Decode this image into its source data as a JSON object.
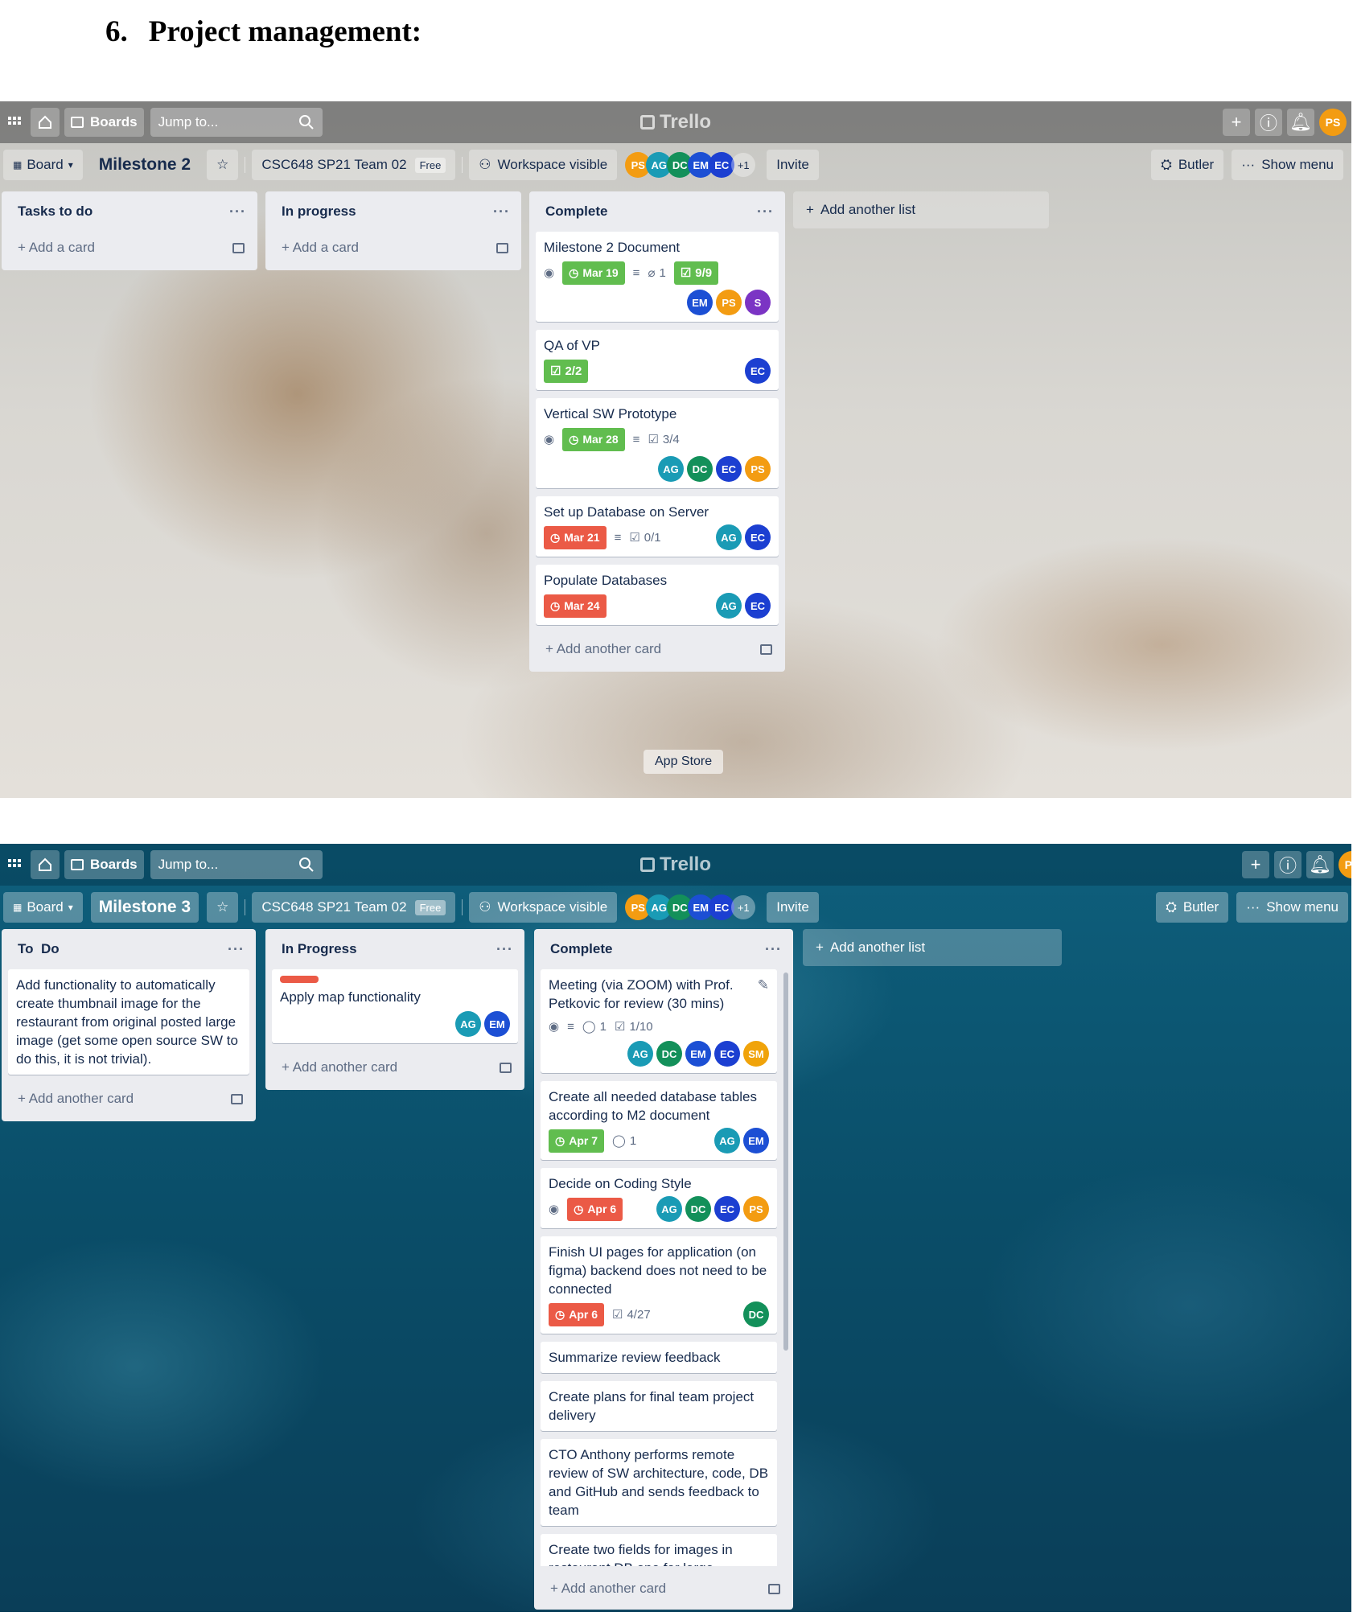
{
  "heading": {
    "number": "6.",
    "text": "Project management:"
  },
  "common": {
    "boards_label": "Boards",
    "jump_placeholder": "Jump to...",
    "logo_text": "Trello",
    "board_view_label": "Board",
    "workspace_name": "CSC648 SP21 Team 02",
    "free_badge": "Free",
    "visibility_label": "Workspace visible",
    "invite_label": "Invite",
    "butler_label": "Butler",
    "show_menu_label": "Show menu",
    "add_list_label": "Add another list",
    "more_members": "+1",
    "user_initials": "PS",
    "members": [
      "PS",
      "AG",
      "DC",
      "EM",
      "EC"
    ],
    "member_colors": {
      "PS": "#f39c12",
      "AG": "#1a9bb5",
      "DC": "#13905a",
      "EM": "#1c4fd4",
      "EC": "#1c3fd1",
      "S": "#7b34c4",
      "SM": "#f0a30a"
    }
  },
  "board1": {
    "title": "Milestone 2",
    "app_store_label": "App Store",
    "lists": [
      {
        "name": "Tasks to do",
        "add_label": "Add a card"
      },
      {
        "name": "In progress",
        "add_label": "Add a card"
      },
      {
        "name": "Complete",
        "add_label": "Add another card",
        "cards": [
          {
            "title": "Milestone 2 Document",
            "due": "Mar 19",
            "attachments": "1",
            "checklist": "9/9",
            "members": [
              "EM",
              "PS",
              "S"
            ]
          },
          {
            "title": "QA of VP",
            "checklist": "2/2",
            "members": [
              "EC"
            ]
          },
          {
            "title": "Vertical SW Prototype",
            "due": "Mar 28",
            "checklist": "3/4",
            "members": [
              "AG",
              "DC",
              "EC",
              "PS"
            ]
          },
          {
            "title": "Set up Database on Server",
            "due": "Mar 21",
            "checklist": "0/1",
            "members": [
              "AG",
              "EC"
            ]
          },
          {
            "title": "Populate Databases",
            "due": "Mar 24",
            "members": [
              "AG",
              "EC"
            ]
          }
        ]
      }
    ]
  },
  "board2": {
    "title": "Milestone 3",
    "lists": [
      {
        "name": "To  Do",
        "add_label": "Add another card",
        "cards": [
          {
            "title": "Add functionality to automatically create thumbnail image for the restaurant from original posted large image (get some open source SW to do this, it is not trivial)."
          }
        ]
      },
      {
        "name": "In Progress",
        "add_label": "Add another card",
        "cards": [
          {
            "title": "Apply map functionality",
            "members": [
              "AG",
              "EM"
            ]
          }
        ]
      },
      {
        "name": "Complete",
        "add_label": "Add another card",
        "cards": [
          {
            "title": "Meeting (via ZOOM) with Prof. Petkovic for review (30 mins)",
            "comments": "1",
            "checklist": "1/10",
            "members": [
              "AG",
              "DC",
              "EM",
              "EC",
              "SM"
            ]
          },
          {
            "title": "Create all needed database tables according to M2 document",
            "due": "Apr 7",
            "comments": "1",
            "members": [
              "AG",
              "EM"
            ]
          },
          {
            "title": "Decide on Coding Style",
            "due": "Apr 6",
            "members": [
              "AG",
              "DC",
              "EC",
              "PS"
            ]
          },
          {
            "title": "Finish UI pages for application (on figma) backend does not need to be connected",
            "due": "Apr 6",
            "checklist": "4/27",
            "members": [
              "DC"
            ]
          },
          {
            "title": "Summarize review feedback"
          },
          {
            "title": "Create plans for final team project delivery"
          },
          {
            "title": "CTO Anthony performs remote review of SW architecture, code, DB and GitHub and sends feedback to team"
          },
          {
            "title": "Create two fields for images in restaurant DB one for large"
          }
        ]
      }
    ]
  }
}
